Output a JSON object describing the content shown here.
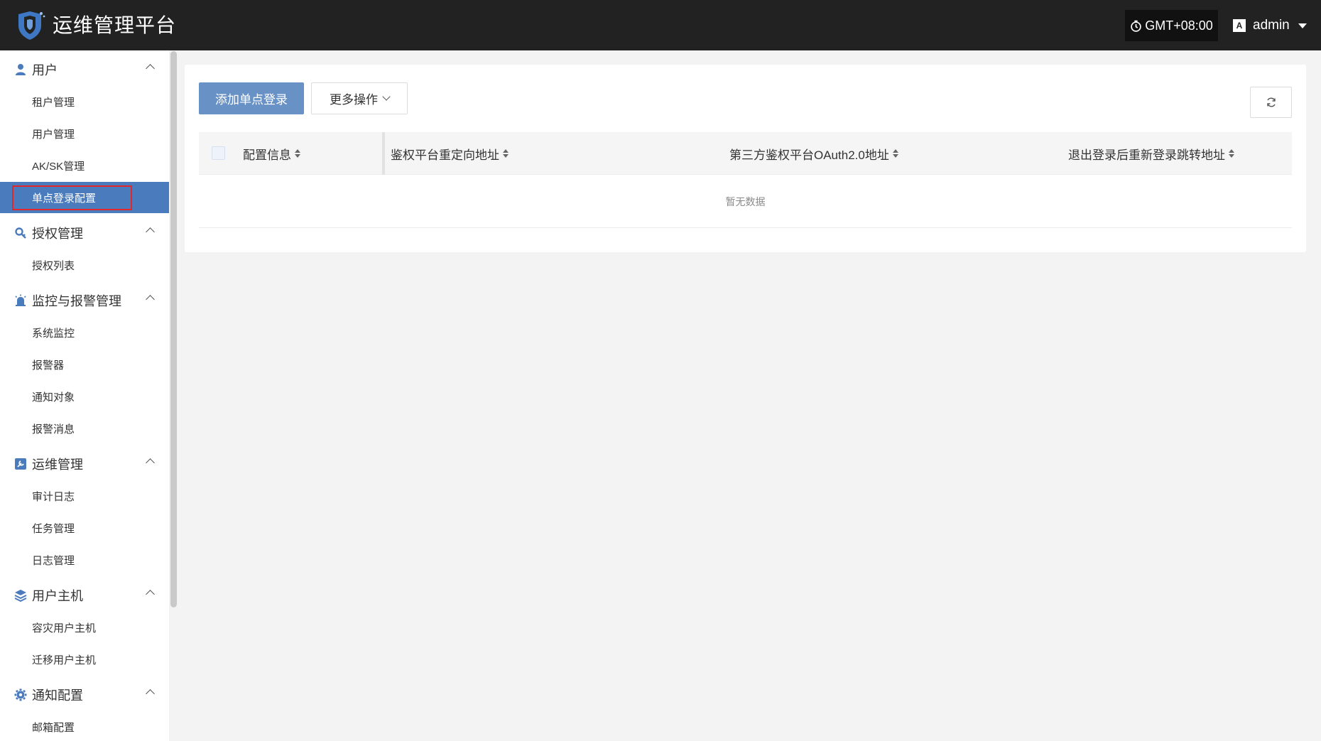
{
  "header": {
    "title": "运维管理平台",
    "timezone": "GMT+08:00",
    "lang_badge": "A",
    "username": "admin"
  },
  "sidebar": {
    "groups": [
      {
        "label": "用户",
        "icon": "user-icon",
        "items": [
          "租户管理",
          "用户管理",
          "AK/SK管理",
          "单点登录配置"
        ]
      },
      {
        "label": "授权管理",
        "icon": "authorization-icon",
        "items": [
          "授权列表"
        ]
      },
      {
        "label": "监控与报警管理",
        "icon": "alarm-icon",
        "items": [
          "系统监控",
          "报警器",
          "通知对象",
          "报警消息"
        ]
      },
      {
        "label": "运维管理",
        "icon": "ops-icon",
        "items": [
          "审计日志",
          "任务管理",
          "日志管理"
        ]
      },
      {
        "label": "用户主机",
        "icon": "layers-icon",
        "items": [
          "容灾用户主机",
          "迁移用户主机"
        ]
      },
      {
        "label": "通知配置",
        "icon": "gear-icon",
        "items": [
          "邮箱配置"
        ]
      }
    ],
    "active_item": "单点登录配置"
  },
  "toolbar": {
    "add_label": "添加单点登录",
    "more_label": "更多操作"
  },
  "table": {
    "columns": [
      "配置信息",
      "鉴权平台重定向地址",
      "第三方鉴权平台OAuth2.0地址",
      "退出登录后重新登录跳转地址"
    ],
    "empty_text": "暂无数据"
  },
  "colors": {
    "header_bg": "#222222",
    "accent": "#4a7bbd",
    "primary_button": "#6891c6",
    "highlight_border": "#e0282c",
    "shield_blue": "#3e78c4"
  }
}
